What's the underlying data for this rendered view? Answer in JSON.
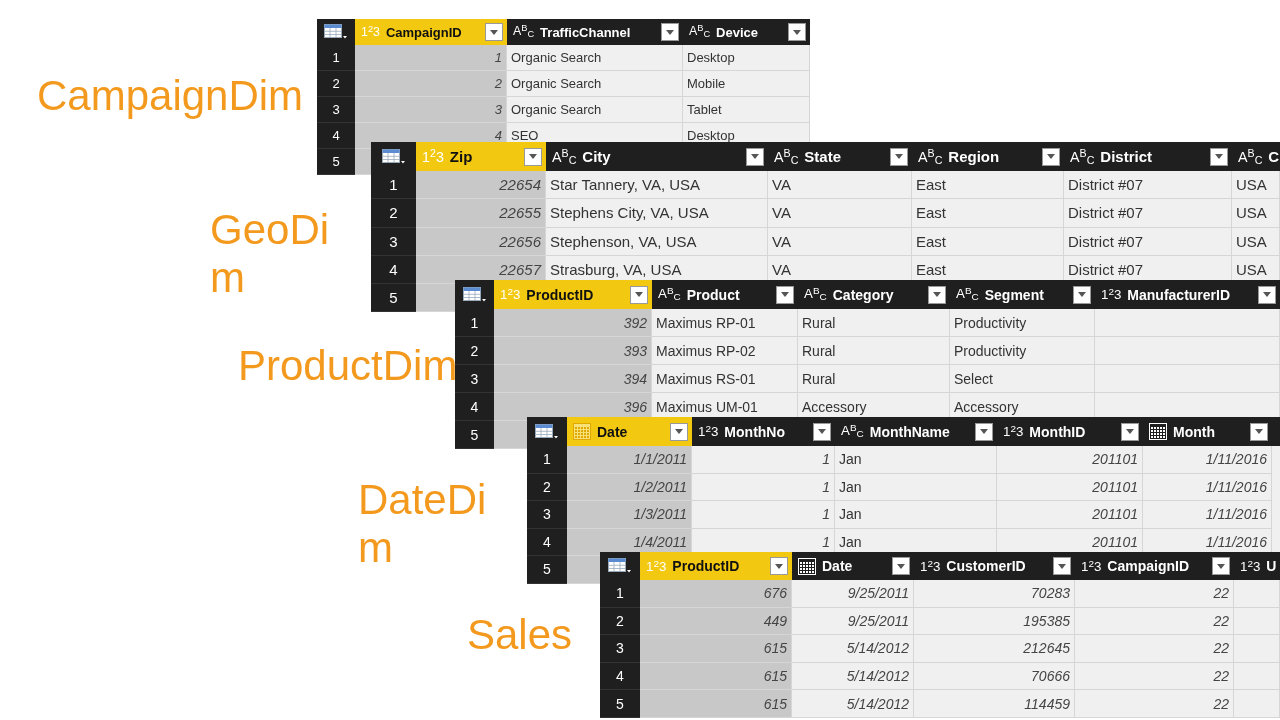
{
  "tables": [
    {
      "name": "CampaignDim",
      "columns": [
        {
          "label": "CampaignID",
          "kind": "number",
          "icon": "1$^{2}$3",
          "selected": true,
          "filter": true
        },
        {
          "label": "TrafficChannel",
          "kind": "text",
          "icon": "A$^{B}$$_{C}$",
          "selected": false,
          "filter": true
        },
        {
          "label": "Device",
          "kind": "text",
          "icon": "A$^{B}$$_{C}$",
          "selected": false,
          "filter": true
        }
      ],
      "rows": [
        {
          "index": "1",
          "cells": [
            "1",
            "Organic Search",
            "Desktop"
          ]
        },
        {
          "index": "2",
          "cells": [
            "2",
            "Organic Search",
            "Mobile"
          ]
        },
        {
          "index": "3",
          "cells": [
            "3",
            "Organic Search",
            "Tablet"
          ]
        },
        {
          "index": "4",
          "cells": [
            "4",
            "SEO",
            "Desktop"
          ]
        },
        {
          "index": "5"
        }
      ]
    },
    {
      "name": "GeoDim",
      "columns": [
        {
          "label": "Zip",
          "kind": "number",
          "icon": "1$^{2}$3",
          "selected": true,
          "filter": true
        },
        {
          "label": "City",
          "kind": "text",
          "icon": "A$^{B}$$_{C}$",
          "selected": false,
          "filter": true
        },
        {
          "label": "State",
          "kind": "text",
          "icon": "A$^{B}$$_{C}$",
          "selected": false,
          "filter": true
        },
        {
          "label": "Region",
          "kind": "text",
          "icon": "A$^{B}$$_{C}$",
          "selected": false,
          "filter": true
        },
        {
          "label": "District",
          "kind": "text",
          "icon": "A$^{B}$$_{C}$",
          "selected": false,
          "filter": true
        },
        {
          "label": "C",
          "kind": "text",
          "icon": "A$^{B}$$_{C}$",
          "selected": false,
          "filter": false
        }
      ],
      "rows": [
        {
          "index": "1",
          "cells": [
            "22654",
            "Star Tannery, VA, USA",
            "VA",
            "East",
            "District #07",
            "USA"
          ]
        },
        {
          "index": "2",
          "cells": [
            "22655",
            "Stephens City, VA, USA",
            "VA",
            "East",
            "District #07",
            "USA"
          ]
        },
        {
          "index": "3",
          "cells": [
            "22656",
            "Stephenson, VA, USA",
            "VA",
            "East",
            "District #07",
            "USA"
          ]
        },
        {
          "index": "4",
          "cells": [
            "22657",
            "Strasburg, VA, USA",
            "VA",
            "East",
            "District #07",
            "USA"
          ]
        },
        {
          "index": "5"
        }
      ]
    },
    {
      "name": "ProductDim",
      "columns": [
        {
          "label": "ProductID",
          "kind": "number",
          "icon": "1$^{2}$3",
          "selected": true,
          "filter": true
        },
        {
          "label": "Product",
          "kind": "text",
          "icon": "A$^{B}$$_{C}$",
          "selected": false,
          "filter": true
        },
        {
          "label": "Category",
          "kind": "text",
          "icon": "A$^{B}$$_{C}$",
          "selected": false,
          "filter": true
        },
        {
          "label": "Segment",
          "kind": "text",
          "icon": "A$^{B}$$_{C}$",
          "selected": false,
          "filter": true
        },
        {
          "label": "ManufacturerID",
          "kind": "number",
          "icon": "1$^{2}$3",
          "selected": false,
          "filter": true
        }
      ],
      "rows": [
        {
          "index": "1",
          "cells": [
            "392",
            "Maximus RP-01",
            "Rural",
            "Productivity"
          ]
        },
        {
          "index": "2",
          "cells": [
            "393",
            "Maximus RP-02",
            "Rural",
            "Productivity"
          ]
        },
        {
          "index": "3",
          "cells": [
            "394",
            "Maximus RS-01",
            "Rural",
            "Select"
          ]
        },
        {
          "index": "4",
          "cells": [
            "396",
            "Maximus UM-01",
            "Accessory",
            "Accessory"
          ]
        },
        {
          "index": "5"
        }
      ]
    },
    {
      "name": "DateDim",
      "columns": [
        {
          "label": "Date",
          "kind": "date",
          "selected": true,
          "filter": true
        },
        {
          "label": "MonthNo",
          "kind": "number",
          "icon": "1$^{2}$3",
          "selected": false,
          "filter": true
        },
        {
          "label": "MonthName",
          "kind": "text",
          "icon": "A$^{B}$$_{C}$",
          "selected": false,
          "filter": true
        },
        {
          "label": "MonthID",
          "kind": "number",
          "icon": "1$^{2}$3",
          "selected": false,
          "filter": true
        },
        {
          "label": "Month",
          "kind": "date",
          "selected": false,
          "filter": true
        }
      ],
      "rows": [
        {
          "index": "1",
          "cells": [
            "1/1/2011",
            "1",
            "Jan",
            "201101",
            "1/11/2016"
          ]
        },
        {
          "index": "2",
          "cells": [
            "1/2/2011",
            "1",
            "Jan",
            "201101",
            "1/11/2016"
          ]
        },
        {
          "index": "3",
          "cells": [
            "1/3/2011",
            "1",
            "Jan",
            "201101",
            "1/11/2016"
          ]
        },
        {
          "index": "4",
          "cells": [
            "1/4/2011",
            "1",
            "Jan",
            "201101",
            "1/11/2016"
          ]
        },
        {
          "index": "5"
        }
      ]
    },
    {
      "name": "Sales",
      "columns": [
        {
          "label": "ProductID",
          "kind": "number",
          "icon": "1$^{2}$3",
          "selected": true,
          "filter": true
        },
        {
          "label": "Date",
          "kind": "date",
          "selected": false,
          "filter": true
        },
        {
          "label": "CustomerID",
          "kind": "number",
          "icon": "1$^{2}$3",
          "selected": false,
          "filter": true
        },
        {
          "label": "CampaignID",
          "kind": "number",
          "icon": "1$^{2}$3",
          "selected": false,
          "filter": true
        },
        {
          "label": "U",
          "kind": "number",
          "icon": "1$^{2}$3",
          "selected": false,
          "filter": false
        }
      ],
      "rows": [
        {
          "index": "1",
          "cells": [
            "676",
            "9/25/2011",
            "70283",
            "22"
          ]
        },
        {
          "index": "2",
          "cells": [
            "449",
            "9/25/2011",
            "195385",
            "22"
          ]
        },
        {
          "index": "3",
          "cells": [
            "615",
            "5/14/2012",
            "212645",
            "22"
          ]
        },
        {
          "index": "4",
          "cells": [
            "615",
            "5/14/2012",
            "70666",
            "22"
          ]
        },
        {
          "index": "5",
          "cells": [
            "615",
            "5/14/2012",
            "114459",
            "22"
          ]
        }
      ]
    }
  ]
}
